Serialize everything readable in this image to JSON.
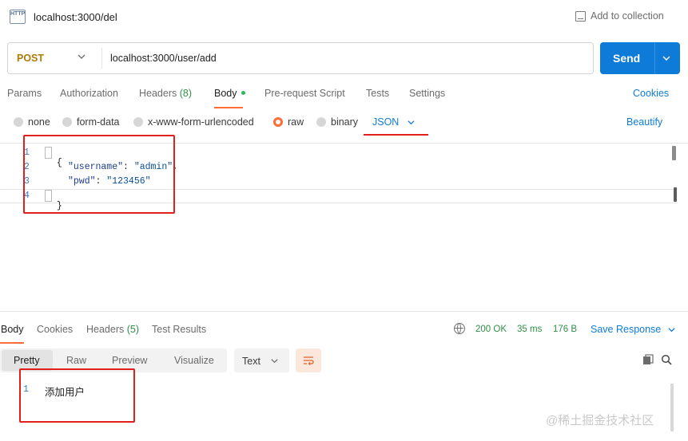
{
  "header": {
    "icon_label": "HTTP",
    "title": "localhost:3000/del",
    "add_to_collection": "Add to collection"
  },
  "request": {
    "method": "POST",
    "url": "localhost:3000/user/add",
    "send_label": "Send"
  },
  "request_tabs": {
    "params": "Params",
    "authorization": "Authorization",
    "headers": "Headers",
    "headers_count": "(8)",
    "body": "Body",
    "pre_request_script": "Pre-request Script",
    "tests": "Tests",
    "settings": "Settings",
    "cookies": "Cookies"
  },
  "body_types": {
    "none": "none",
    "form_data": "form-data",
    "urlencoded": "x-www-form-urlencoded",
    "raw": "raw",
    "binary": "binary",
    "selected": "raw",
    "format": "JSON",
    "beautify": "Beautify"
  },
  "editor": {
    "line_numbers": [
      "1",
      "2",
      "3",
      "4"
    ],
    "open_brace": "{",
    "close_brace": "}",
    "key1": "\"username\"",
    "val1": "\"admin\"",
    "key2": "\"pwd\"",
    "val2": "\"123456\""
  },
  "response_tabs": {
    "body": "Body",
    "cookies": "Cookies",
    "headers": "Headers",
    "headers_count": "(5)",
    "test_results": "Test Results"
  },
  "response_status": {
    "status": "200 OK",
    "time": "35 ms",
    "size": "176 B",
    "save_response": "Save Response"
  },
  "response_view": {
    "pretty": "Pretty",
    "raw": "Raw",
    "preview": "Preview",
    "visualize": "Visualize",
    "format": "Text",
    "line_number": "1",
    "body_text": "添加用户"
  },
  "watermark": "@稀土掘金技术社区",
  "colors": {
    "accent_blue": "#0e7bd9",
    "active_tab": "#ff6c37",
    "method_post": "#ad7a03",
    "annotation_red": "#e1201c"
  }
}
